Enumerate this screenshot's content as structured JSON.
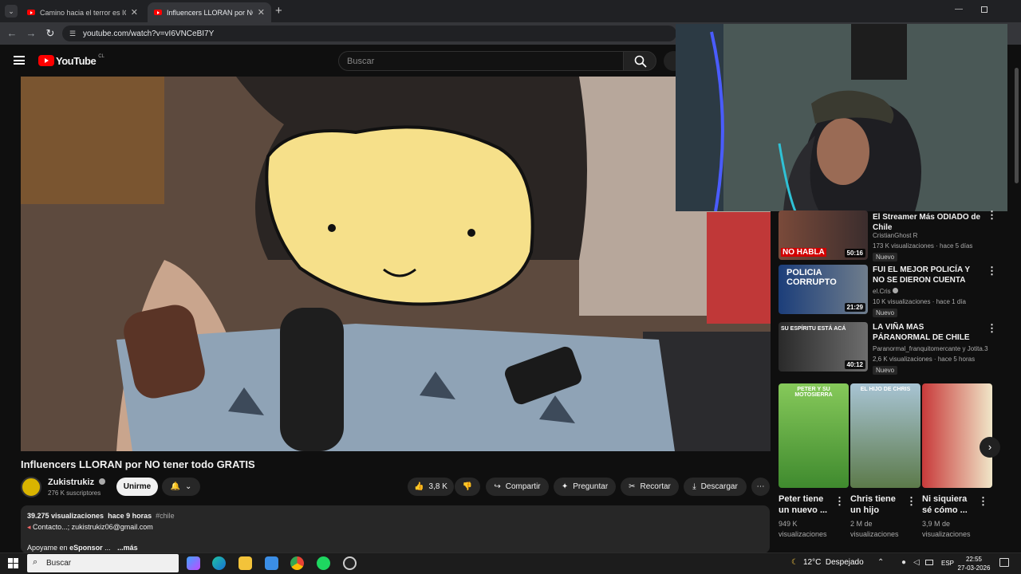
{
  "browser": {
    "tabs": [
      {
        "title": "Camino hacia el terror es ICÓNI"
      },
      {
        "title": "Influencers LLORAN por NO ten"
      }
    ],
    "url": "youtube.com/watch?v=vI6VNCeBI7Y"
  },
  "youtube": {
    "logo": "YouTube",
    "region": "CL",
    "search_placeholder": "Buscar"
  },
  "video": {
    "title": "Influencers LLORAN por NO tener todo GRATIS",
    "channel": "Zukistrukiz",
    "subscribers": "276 K suscriptores",
    "join_label": "Unirme",
    "likes": "3,8 K",
    "share_label": "Compartir",
    "ask_label": "Preguntar",
    "clip_label": "Recortar",
    "download_label": "Descargar",
    "views": "39.275 visualizaciones",
    "age": "hace 9 horas",
    "hashtag": "#chile",
    "contact": "Contacto...; zukistrukiz06@gmail.com",
    "support_prefix": "Apoyame en",
    "support_link": "eSponsor",
    "more_ellipsis": "...",
    "more": "...más"
  },
  "recommendations": [
    {
      "title": "El Streamer Más ODIADO de Chile",
      "channel": "CristianGhost R",
      "meta": "173 K visualizaciones · hace 5 días",
      "badge": "Nuevo",
      "duration": "50:16",
      "thumb_text": "NO HABLA"
    },
    {
      "title": "FUI EL MEJOR POLICÍA Y NO SE DIERON CUENTA QUE ERA ...",
      "channel": "el.Cris",
      "meta": "10 K visualizaciones · hace 1 día",
      "badge": "Nuevo",
      "duration": "21:29",
      "thumb_text": "POLICIA CORRUPTO"
    },
    {
      "title": "LA VIÑA MAS PÁRANORMAL DE CHILE SENTIMOS SUS ...",
      "channel": "Paranormal_franquitomercante y Jotita.3",
      "meta": "2,6 K visualizaciones · hace 5 horas",
      "badge": "Nuevo",
      "duration": "40:12",
      "thumb_text": "SU ESPÍRITU ESTÁ ACÁ"
    }
  ],
  "shorts": [
    {
      "title_l1": "Peter tiene",
      "title_l2": "un nuevo ...",
      "views_l1": "949 K",
      "views_l2": "visualizaciones",
      "thumb_text": "PETER Y SU MOTOSIERRA"
    },
    {
      "title_l1": "Chris tiene",
      "title_l2": "un hijo",
      "views_l1": "2 M de",
      "views_l2": "visualizaciones",
      "thumb_text": "EL HIJO DE CHRIS"
    },
    {
      "title_l1": "Ni siquiera",
      "title_l2": "sé cómo ...",
      "views_l1": "3,9 M de",
      "views_l2": "visualizaciones",
      "thumb_text": ""
    }
  ],
  "taskbar": {
    "search_placeholder": "Buscar",
    "weather": "12°C  Despejado",
    "lang": "ESP",
    "time": "22:55",
    "date": "27-03-2026"
  },
  "colors": {
    "accent": "#ff0000",
    "background": "#0f0f0f",
    "pill": "#272727"
  }
}
